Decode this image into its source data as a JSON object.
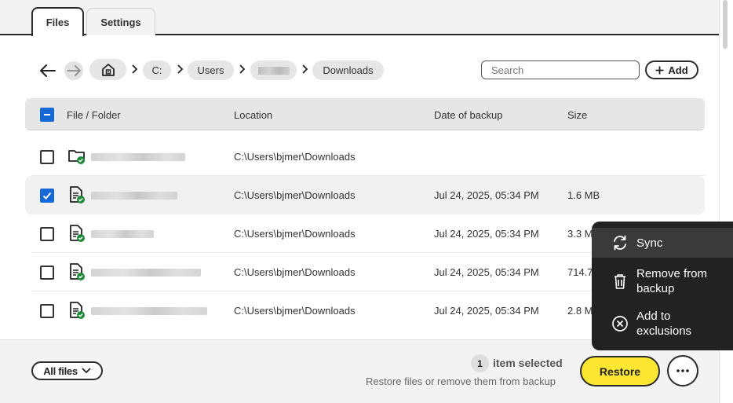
{
  "tabs": {
    "files": "Files",
    "settings": "Settings"
  },
  "breadcrumb": {
    "drive": "C:",
    "users": "Users",
    "downloads": "Downloads"
  },
  "search": {
    "placeholder": "Search"
  },
  "toolbar": {
    "add_label": "Add"
  },
  "table": {
    "headers": {
      "name": "File / Folder",
      "location": "Location",
      "date": "Date of backup",
      "size": "Size"
    },
    "rows": [
      {
        "type": "folder",
        "selected": false,
        "location": "C:\\Users\\bjmer\\Downloads",
        "date": "",
        "size": ""
      },
      {
        "type": "file",
        "selected": true,
        "location": "C:\\Users\\bjmer\\Downloads",
        "date": "Jul 24, 2025, 05:34 PM",
        "size": "1.6 MB"
      },
      {
        "type": "file",
        "selected": false,
        "location": "C:\\Users\\bjmer\\Downloads",
        "date": "Jul 24, 2025, 05:34 PM",
        "size": "3.3 M"
      },
      {
        "type": "file",
        "selected": false,
        "location": "C:\\Users\\bjmer\\Downloads",
        "date": "Jul 24, 2025, 05:34 PM",
        "size": "714.7"
      },
      {
        "type": "file",
        "selected": false,
        "location": "C:\\Users\\bjmer\\Downloads",
        "date": "Jul 24, 2025, 05:34 PM",
        "size": "2.8 M"
      }
    ]
  },
  "footer": {
    "filter_label": "All files",
    "selected_count": "1",
    "selected_text": "item selected",
    "hint": "Restore files or remove them from backup",
    "restore_label": "Restore"
  },
  "context_menu": {
    "sync": "Sync",
    "remove_line1": "Remove from",
    "remove_line2": "backup",
    "exclude_line1": "Add to",
    "exclude_line2": "exclusions"
  },
  "colors": {
    "accent": "#1469d6",
    "restore": "#ffe633",
    "menu_bg": "#222222",
    "check_green": "#1f8a3a"
  }
}
